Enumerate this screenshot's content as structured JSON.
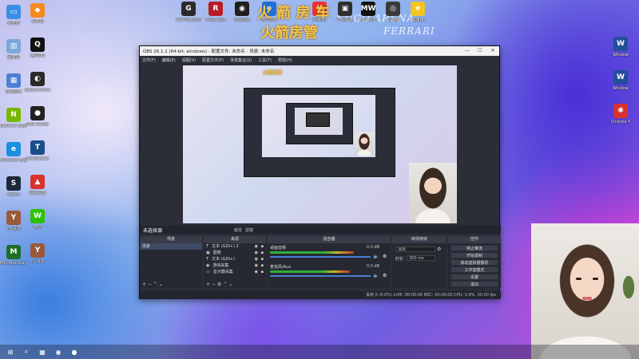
{
  "overlay": {
    "line1": "火 箭 房 车",
    "line2": "火箭房管"
  },
  "bg_brand": {
    "left": "SUGO ARENA",
    "right": "FERRARI"
  },
  "top_icons": [
    {
      "label": "Gaming 游戏",
      "color": "#2a2a2a",
      "glyph": "G"
    },
    {
      "label": "RAGE 战神",
      "color": "#b81d25",
      "glyph": "R"
    },
    {
      "label": "游戏加速",
      "color": "#1e1e1e",
      "glyph": "◉"
    },
    {
      "label": "微软加速",
      "color": "#2170d6",
      "glyph": "e"
    },
    {
      "label": "网易UU",
      "color": "#e8352f",
      "glyph": "U"
    },
    {
      "label": "游戏加速",
      "color": "#2f2f2f",
      "glyph": "▣"
    },
    {
      "label": "MW 战地",
      "color": "#111",
      "glyph": "MW"
    },
    {
      "label": "加速器",
      "color": "#3a3a3a",
      "glyph": "◎"
    },
    {
      "label": "加速器",
      "color": "#f2c524",
      "glyph": "★"
    }
  ],
  "left_icons": [
    {
      "label": "此电脑",
      "color": "#3a8ee6",
      "glyph": "▭"
    },
    {
      "label": "回收站",
      "color": "#7aa8d8",
      "glyph": "▥"
    },
    {
      "label": "控制面板",
      "color": "#4f7fd4",
      "glyph": "▦"
    },
    {
      "label": "GeForce Experience",
      "color": "#76b900",
      "glyph": "N"
    },
    {
      "label": "Microsoft Edge",
      "color": "#1b8fe0",
      "glyph": "e"
    },
    {
      "label": "Steam",
      "color": "#1b2838",
      "glyph": "S"
    },
    {
      "label": "Yy 语音",
      "color": "#9a5a3a",
      "glyph": "Y"
    },
    {
      "label": "MSI Afterburner",
      "color": "#1f6e2a",
      "glyph": "M"
    }
  ],
  "left_icons_2": [
    {
      "label": "计算机",
      "color": "#f58a1f",
      "glyph": "◆"
    },
    {
      "label": "腾讯QQ",
      "color": "#111",
      "glyph": "Q"
    },
    {
      "label": "EasyConnect",
      "color": "#2a2a2a",
      "glyph": "◐"
    },
    {
      "label": "OBS Studio",
      "color": "#222",
      "glyph": "●"
    },
    {
      "label": "TeamSpeak",
      "color": "#1b4d8a",
      "glyph": "T"
    },
    {
      "label": "网易邮箱",
      "color": "#d9322e",
      "glyph": "▲"
    },
    {
      "label": "微信",
      "color": "#2dc100",
      "glyph": "W"
    },
    {
      "label": "Yy 语音",
      "color": "#9a5a3a",
      "glyph": "Y"
    }
  ],
  "right_icons": [
    {
      "label": "Window",
      "color": "#244d9a",
      "glyph": "W"
    },
    {
      "label": "Window",
      "color": "#244d9a",
      "glyph": "W"
    },
    {
      "label": "Chrome 5",
      "color": "#d9322e",
      "glyph": "✱"
    }
  ],
  "obs": {
    "title": "OBS 26.1.1 (64-bit, windows) - 配置文件: 未命名 - 场景: 未命名",
    "menu": [
      "文件(F)",
      "编辑(E)",
      "视图(V)",
      "配置文件(P)",
      "场景集合(S)",
      "工具(T)",
      "帮助(H)"
    ],
    "window_controls": [
      "—",
      "☐",
      "✕"
    ],
    "dock_bar": {
      "scene_label": "未选择源",
      "props": "属性",
      "filters": "滤镜"
    },
    "dock_titles": {
      "scenes": "场景",
      "sources": "来源",
      "mixer": "混音器",
      "transitions": "转场特效",
      "controls": "控件"
    },
    "scenes": [
      "场景"
    ],
    "sources": [
      {
        "icon": "T",
        "name": "文本 (GDI+) 2"
      },
      {
        "icon": "▣",
        "name": "图像"
      },
      {
        "icon": "T",
        "name": "文本 (GDI+)"
      },
      {
        "icon": "◉",
        "name": "游戏采集"
      },
      {
        "icon": "▭",
        "name": "显示器采集"
      }
    ],
    "mixer": [
      {
        "name": "桌面音频",
        "db": "0.0 dB",
        "level": 0.82
      },
      {
        "name": "麦克风/Aux",
        "db": "0.0 dB",
        "level": 0.78
      }
    ],
    "transition": {
      "type": "淡出",
      "duration_label": "时长",
      "duration": "300 ms"
    },
    "controls": [
      "停止推流",
      "开始录制",
      "启动虚拟摄像机",
      "工作室模式",
      "设置",
      "退出"
    ],
    "status": "丢帧 0 (0.0%)   LIVE: 00:00:00   REC: 00:00:00   CPU: 3.9%, 30.00 fps"
  },
  "taskbar_icons": [
    "⊞",
    "⌕",
    "▦",
    "◉",
    "●"
  ],
  "colors": {
    "obs_bg": "#2b2e38",
    "obs_dock": "#262932",
    "meter_green": "#2fae3a",
    "overlay_gold": "#f6c84a"
  }
}
